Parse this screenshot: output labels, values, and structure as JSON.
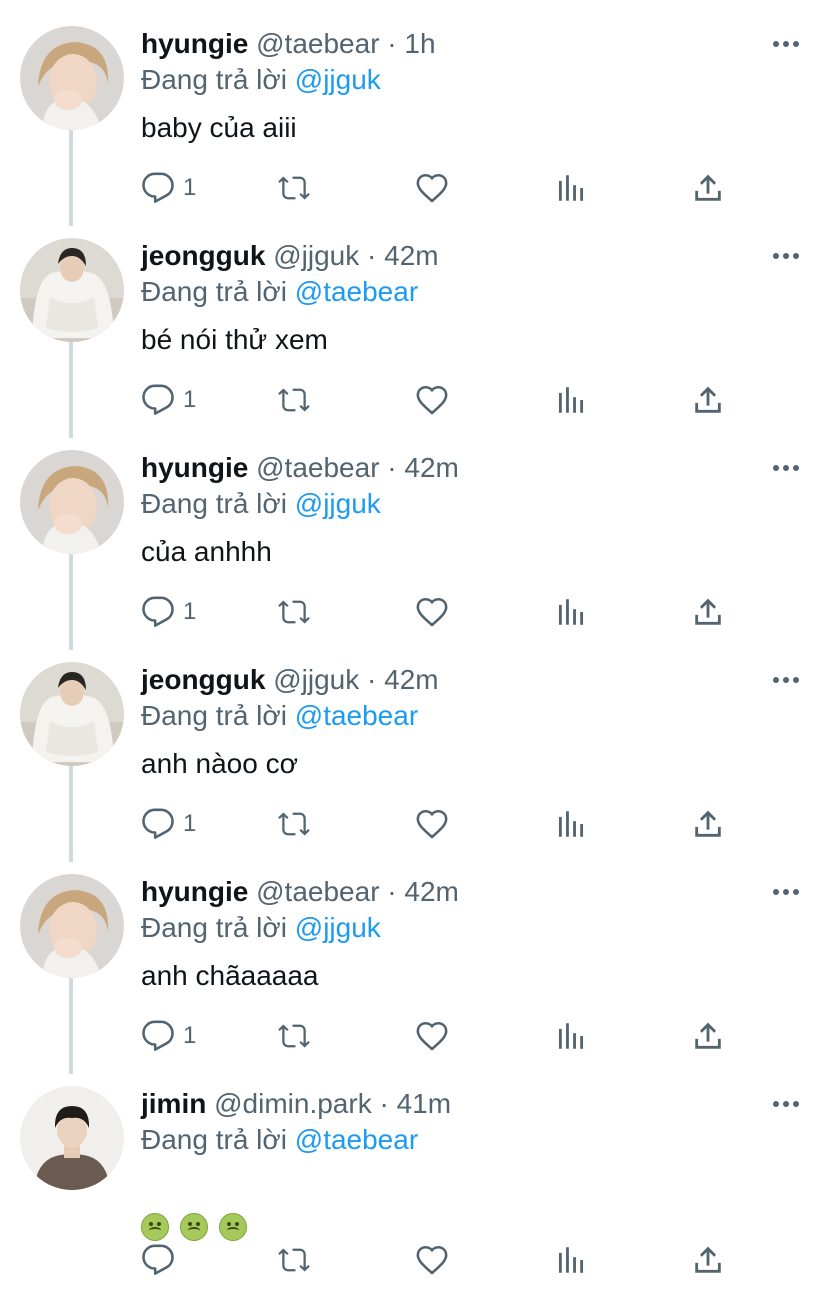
{
  "tweets": [
    {
      "name": "hyungie",
      "handle": "@taebear",
      "time": "· 1h",
      "replying_prefix": "Đang trả lời",
      "replying_to": "@jjguk",
      "text": "baby của aiii",
      "reply_count": "1",
      "avatar": "avatar-taebear"
    },
    {
      "name": "jeongguk",
      "handle": "@jjguk",
      "time": "· 42m",
      "replying_prefix": "Đang trả lời",
      "replying_to": "@taebear",
      "text": "bé nói thử xem",
      "reply_count": "1",
      "avatar": "avatar-jjguk"
    },
    {
      "name": "hyungie",
      "handle": "@taebear",
      "time": "· 42m",
      "replying_prefix": "Đang trả lời",
      "replying_to": "@jjguk",
      "text": "của anhhh",
      "reply_count": "1",
      "avatar": "avatar-taebear"
    },
    {
      "name": "jeongguk",
      "handle": "@jjguk",
      "time": "· 42m",
      "replying_prefix": "Đang trả lời",
      "replying_to": "@taebear",
      "text": "anh nàoo cơ",
      "reply_count": "1",
      "avatar": "avatar-jjguk"
    },
    {
      "name": "hyungie",
      "handle": "@taebear",
      "time": "· 42m",
      "replying_prefix": "Đang trả lời",
      "replying_to": "@jjguk",
      "text": "anh chãaaaaa",
      "reply_count": "1",
      "avatar": "avatar-taebear"
    },
    {
      "name": "jimin",
      "handle": "@dimin.park",
      "time": "· 41m",
      "replying_prefix": "Đang trả lời",
      "replying_to": "@taebear",
      "text": "",
      "emojis": [
        "nauseated-face",
        "nauseated-face",
        "nauseated-face"
      ],
      "reply_count": "",
      "avatar": "avatar-dimin"
    }
  ],
  "icons": {
    "reply": "reply-icon",
    "retweet": "retweet-icon",
    "like": "heart-icon",
    "views": "bar-chart-icon",
    "share": "share-icon",
    "more": "more-dots-icon"
  },
  "colors": {
    "text": "#0f1419",
    "secondary": "#536471",
    "mention": "#1d9bf0",
    "thread_line": "#cfd9de"
  }
}
